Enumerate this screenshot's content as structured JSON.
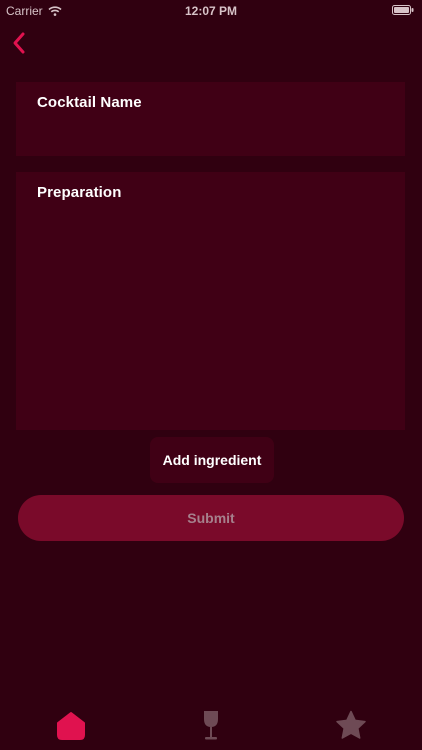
{
  "status_bar": {
    "carrier": "Carrier",
    "time": "12:07 PM"
  },
  "header": {
    "back_icon": "chevron-left-icon"
  },
  "form": {
    "cocktail_name_label": "Cocktail Name",
    "cocktail_name_value": "",
    "preparation_label": "Preparation",
    "preparation_value": "",
    "add_ingredient_label": "Add ingredient",
    "submit_label": "Submit"
  },
  "tab_bar": {
    "tabs": [
      {
        "icon": "home-icon",
        "active": true
      },
      {
        "icon": "wine-glass-icon",
        "active": false
      },
      {
        "icon": "star-icon",
        "active": false
      }
    ]
  },
  "colors": {
    "background": "#300010",
    "field_background": "#400015",
    "accent": "#e0124f",
    "submit_background": "#7a0a2a",
    "inactive_icon": "#6e4a55"
  }
}
